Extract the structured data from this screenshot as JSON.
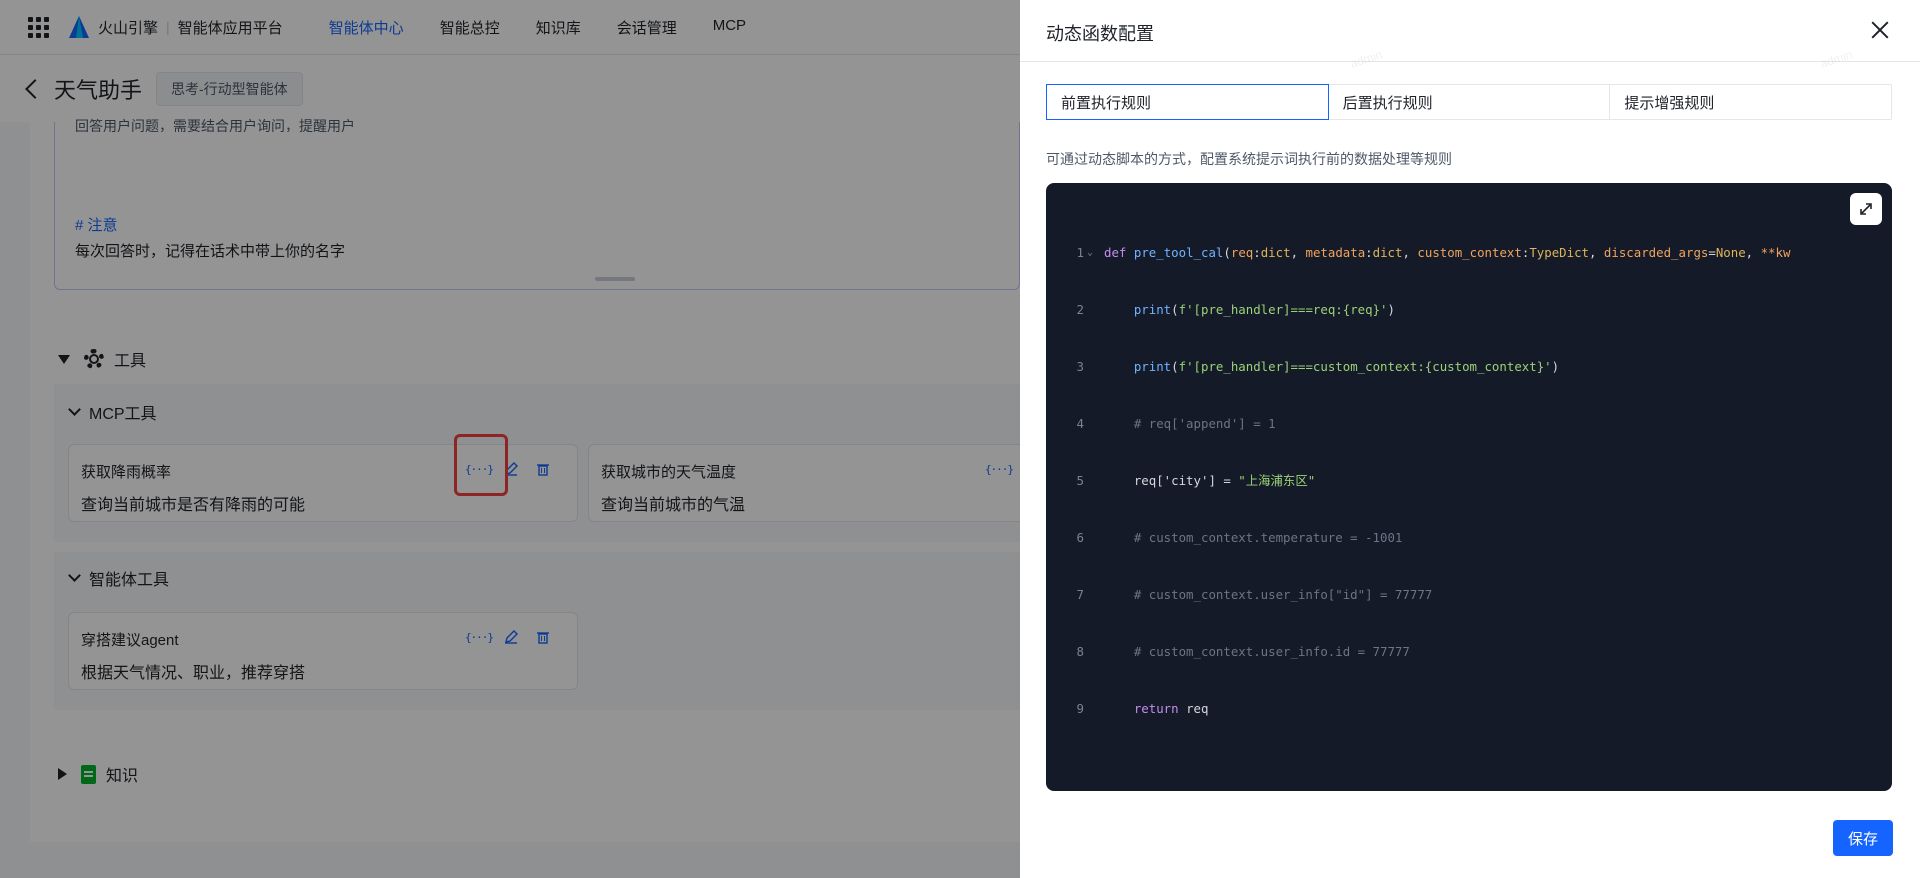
{
  "topnav": {
    "brand": "火山引擎",
    "separator": "|",
    "platform": "智能体应用平台",
    "items": [
      {
        "label": "智能体中心",
        "active": true
      },
      {
        "label": "智能总控",
        "active": false
      },
      {
        "label": "知识库",
        "active": false
      },
      {
        "label": "会话管理",
        "active": false
      },
      {
        "label": "MCP",
        "active": false
      }
    ]
  },
  "agent": {
    "title": "天气助手",
    "tag": "思考-行动型智能体"
  },
  "prompt": {
    "partial_line": "回答用户问题，需要结合用户询问，提醒用户",
    "heading": "# 注意",
    "text": "每次回答时，记得在话术中带上你的名字"
  },
  "tools": {
    "section_label": "工具",
    "mcp_label": "MCP工具",
    "mcp_tools": [
      {
        "name": "获取降雨概率",
        "desc": "查询当前城市是否有降雨的可能"
      },
      {
        "name": "获取城市的天气温度",
        "desc": "查询当前城市的气温"
      }
    ],
    "agent_label": "智能体工具",
    "agent_tools": [
      {
        "name": "穿搭建议agent",
        "desc": "根据天气情况、职业，推荐穿搭"
      }
    ],
    "fx_glyph": "{···}"
  },
  "knowledge": {
    "section_label": "知识"
  },
  "drawer": {
    "title": "动态函数配置",
    "tabs": [
      {
        "label": "前置执行规则",
        "active": true
      },
      {
        "label": "后置执行规则",
        "active": false
      },
      {
        "label": "提示增强规则",
        "active": false
      }
    ],
    "hint": "可通过动态脚本的方式，配置系统提示词执行前的数据处理等规则",
    "save_label": "保存",
    "watermark": "admin"
  },
  "code": {
    "line_numbers": [
      "1",
      "2",
      "3",
      "4",
      "5",
      "6",
      "7",
      "8",
      "9"
    ],
    "l1": {
      "def": "def",
      "fn": "pre_tool_cal",
      "p1": "req",
      "t1": "dict",
      "p2": "metadata",
      "t2": "dict",
      "p3": "custom_context",
      "t3": "TypeDict",
      "p4": "discarded_args",
      "d4": "None",
      "rest": "**kw"
    },
    "l2": {
      "call": "print",
      "str": "f'[pre_handler]===req:{req}'"
    },
    "l3": {
      "call": "print",
      "str": "f'[pre_handler]===custom_context:{custom_context}'"
    },
    "l4": "# req['append'] = 1",
    "l5": {
      "lhs": "req['city']",
      "eq": " = ",
      "str": "\"上海浦东区\""
    },
    "l6": "# custom_context.temperature = -1001",
    "l7": "# custom_context.user_info[\"id\"] = 77777",
    "l8": "# custom_context.user_info.id = 77777",
    "l9": {
      "kw": "return",
      "val": "req"
    }
  },
  "colors": {
    "accent": "#1664ff",
    "highlight": "#f53f3f",
    "editor_bg": "#141a27"
  }
}
